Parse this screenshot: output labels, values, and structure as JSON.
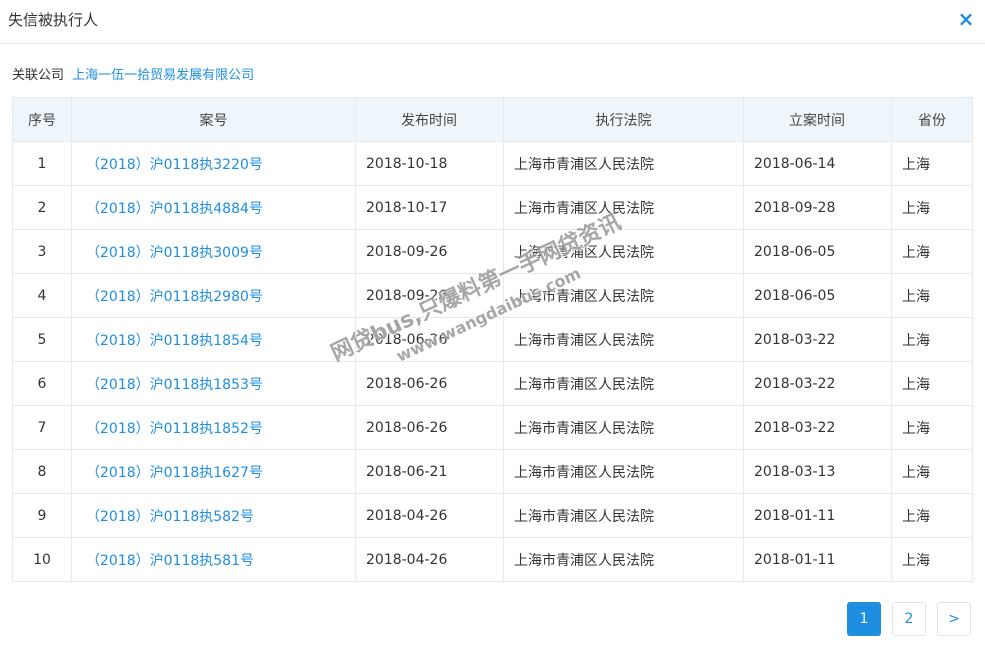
{
  "modal": {
    "title": "失信被执行人",
    "close_symbol": "×"
  },
  "company": {
    "label": "关联公司",
    "name": "上海一伍一拾贸易发展有限公司"
  },
  "table": {
    "headers": [
      "序号",
      "案号",
      "发布时间",
      "执行法院",
      "立案时间",
      "省份"
    ],
    "rows": [
      {
        "no": "1",
        "case": "（2018）沪0118执3220号",
        "published": "2018-10-18",
        "court": "上海市青浦区人民法院",
        "filed": "2018-06-14",
        "province": "上海"
      },
      {
        "no": "2",
        "case": "（2018）沪0118执4884号",
        "published": "2018-10-17",
        "court": "上海市青浦区人民法院",
        "filed": "2018-09-28",
        "province": "上海"
      },
      {
        "no": "3",
        "case": "（2018）沪0118执3009号",
        "published": "2018-09-26",
        "court": "上海市青浦区人民法院",
        "filed": "2018-06-05",
        "province": "上海"
      },
      {
        "no": "4",
        "case": "（2018）沪0118执2980号",
        "published": "2018-09-26",
        "court": "上海市青浦区人民法院",
        "filed": "2018-06-05",
        "province": "上海"
      },
      {
        "no": "5",
        "case": "（2018）沪0118执1854号",
        "published": "2018-06-26",
        "court": "上海市青浦区人民法院",
        "filed": "2018-03-22",
        "province": "上海"
      },
      {
        "no": "6",
        "case": "（2018）沪0118执1853号",
        "published": "2018-06-26",
        "court": "上海市青浦区人民法院",
        "filed": "2018-03-22",
        "province": "上海"
      },
      {
        "no": "7",
        "case": "（2018）沪0118执1852号",
        "published": "2018-06-26",
        "court": "上海市青浦区人民法院",
        "filed": "2018-03-22",
        "province": "上海"
      },
      {
        "no": "8",
        "case": "（2018）沪0118执1627号",
        "published": "2018-06-21",
        "court": "上海市青浦区人民法院",
        "filed": "2018-03-13",
        "province": "上海"
      },
      {
        "no": "9",
        "case": "（2018）沪0118执582号",
        "published": "2018-04-26",
        "court": "上海市青浦区人民法院",
        "filed": "2018-01-11",
        "province": "上海"
      },
      {
        "no": "10",
        "case": "（2018）沪0118执581号",
        "published": "2018-04-26",
        "court": "上海市青浦区人民法院",
        "filed": "2018-01-11",
        "province": "上海"
      }
    ]
  },
  "pagination": {
    "pages": [
      "1",
      "2"
    ],
    "current": "1",
    "next_symbol": ">"
  },
  "watermark": {
    "line1": "网贷bus,只爆料第一手网贷资讯",
    "line2": "www.wangdaibus.com"
  },
  "colors": {
    "accent": "#1e8fe0",
    "header_bg": "#eef6fc",
    "border": "#e8e8e8"
  }
}
